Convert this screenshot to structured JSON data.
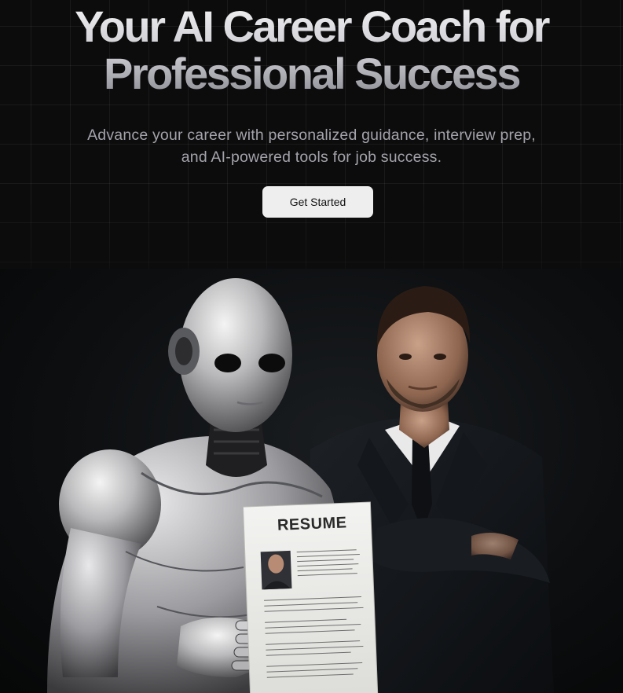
{
  "hero": {
    "title_line1": "Your AI Career Coach for",
    "title_line2": "Professional Success",
    "subtitle": "Advance your career with personalized guidance, interview prep, and AI-powered tools for job success.",
    "cta_label": "Get Started"
  },
  "banner": {
    "resume_heading": "RESUME",
    "image_description_icons": [
      "robot-illustration",
      "businessman-illustration",
      "resume-document"
    ]
  },
  "colors": {
    "background": "#0c0c0d",
    "button_bg": "#eeeeef",
    "button_text": "#111111",
    "subtitle_text": "#a3a3aa"
  }
}
